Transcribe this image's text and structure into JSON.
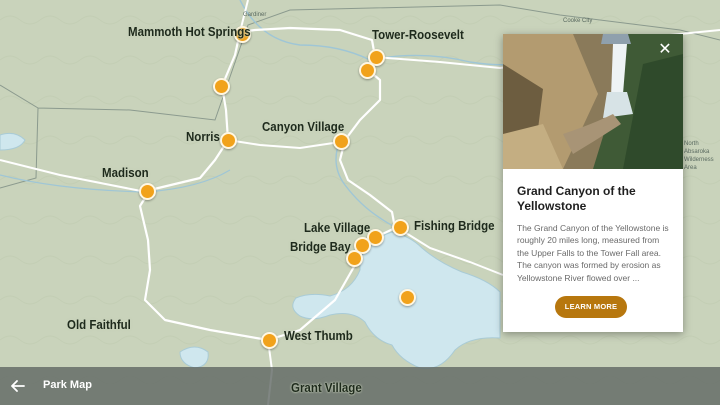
{
  "map": {
    "places": [
      {
        "id": "mammoth",
        "label": "Mammoth Hot Springs"
      },
      {
        "id": "tower",
        "label": "Tower-Roosevelt"
      },
      {
        "id": "norris",
        "label": "Norris"
      },
      {
        "id": "canyon",
        "label": "Canyon Village"
      },
      {
        "id": "madison",
        "label": "Madison"
      },
      {
        "id": "lake",
        "label": "Lake Village"
      },
      {
        "id": "fishing",
        "label": "Fishing Bridge"
      },
      {
        "id": "bridgebay",
        "label": "Bridge Bay"
      },
      {
        "id": "oldfaithful",
        "label": "Old Faithful"
      },
      {
        "id": "westthumb",
        "label": "West Thumb"
      },
      {
        "id": "grant",
        "label": "Grant Village"
      }
    ],
    "small_labels": [
      "Gardiner",
      "Cooke City",
      "North Absaroka Wilderness Area"
    ]
  },
  "card": {
    "title": "Grand Canyon of the Yellowstone",
    "description": "The Grand Canyon of the Yellowstone is roughly 20 miles long, measured from the Upper Falls to the Tower Fall area. The canyon was formed by erosion as Yellowstone River flowed over ...",
    "button_label": "LEARN MORE",
    "close_icon": "close-icon"
  },
  "bottom_bar": {
    "title": "Park Map",
    "back_icon": "arrow-left-icon"
  },
  "colors": {
    "terrain": "#c9d3bb",
    "water": "#cfe7ee",
    "marker": "#f1a21b",
    "button": "#b7770e",
    "bar": "#5c6460"
  }
}
